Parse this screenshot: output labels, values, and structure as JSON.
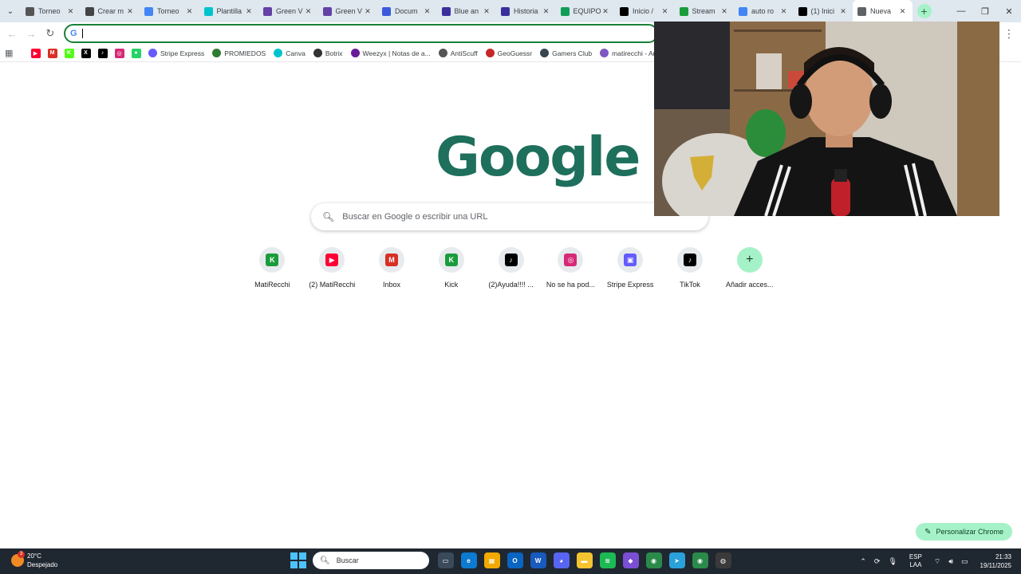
{
  "tabs": [
    {
      "title": "Torneo",
      "icon": "github-icon",
      "color": "#555555"
    },
    {
      "title": "Crear m",
      "icon": "openai-icon",
      "color": "#444444"
    },
    {
      "title": "Torneo",
      "icon": "docs-icon",
      "color": "#4285f4"
    },
    {
      "title": "Plantilla",
      "icon": "canva-icon",
      "color": "#00c4cc"
    },
    {
      "title": "Green V",
      "icon": "twitch-icon",
      "color": "#6441a5"
    },
    {
      "title": "Green V",
      "icon": "twitch-icon",
      "color": "#6441a5"
    },
    {
      "title": "Docum",
      "icon": "docs-icon",
      "color": "#3b5bdb"
    },
    {
      "title": "Blue an",
      "icon": "video-icon",
      "color": "#3b2f9e"
    },
    {
      "title": "Historia",
      "icon": "video-icon",
      "color": "#3b2f9e"
    },
    {
      "title": "EQUIPO",
      "icon": "sheets-icon",
      "color": "#0f9d58"
    },
    {
      "title": "Inicio /",
      "icon": "x-icon",
      "color": "#000000"
    },
    {
      "title": "Stream",
      "icon": "kick-icon",
      "color": "#1a9c3c"
    },
    {
      "title": "auto ro",
      "icon": "google-icon",
      "color": "#4285f4"
    },
    {
      "title": "(1) Inici",
      "icon": "x-icon",
      "color": "#000000"
    },
    {
      "title": "Nueva",
      "icon": "chrome-icon",
      "color": "#5f6368",
      "active": true
    }
  ],
  "bookmark_icons": [
    {
      "name": "youtube-bookmark",
      "color": "#ff0033",
      "glyph": "▶"
    },
    {
      "name": "gmail-bookmark",
      "color": "#d93025",
      "glyph": "M"
    },
    {
      "name": "kick-bookmark",
      "color": "#53fc18",
      "glyph": "K"
    },
    {
      "name": "x-bookmark",
      "color": "#000000",
      "glyph": "X"
    },
    {
      "name": "tiktok-bookmark",
      "color": "#000000",
      "glyph": "♪"
    },
    {
      "name": "instagram-bookmark",
      "color": "#d62976",
      "glyph": "◎"
    },
    {
      "name": "whatsapp-bookmark",
      "color": "#25d366",
      "glyph": "●"
    }
  ],
  "bookmarks": [
    {
      "label": "Stripe Express",
      "color": "#635bff"
    },
    {
      "label": "PROMIEDOS",
      "color": "#2e7d32"
    },
    {
      "label": "Canva",
      "color": "#00c4cc"
    },
    {
      "label": "Botrix",
      "color": "#333333"
    },
    {
      "label": "Weezyx | Notas de a...",
      "color": "#6a1b9a"
    },
    {
      "label": "AntiScuff",
      "color": "#555555"
    },
    {
      "label": "GeoGuessr",
      "color": "#c62828"
    },
    {
      "label": "Gamers Club",
      "color": "#37474f"
    },
    {
      "label": "matirecchi - Audien...",
      "color": "#7e57c2"
    }
  ],
  "logo_text": "Google",
  "search_placeholder": "Buscar en Google o escribir una URL",
  "shortcuts": [
    {
      "label": "MatiRecchi",
      "color": "#1a9c3c",
      "glyph": "K"
    },
    {
      "label": "(2) MatiRecchi",
      "color": "#ff0033",
      "glyph": "▶"
    },
    {
      "label": "Inbox",
      "color": "#d93025",
      "glyph": "M"
    },
    {
      "label": "Kick",
      "color": "#1a9c3c",
      "glyph": "K"
    },
    {
      "label": "(2)Ayuda!!!! ...",
      "color": "#000000",
      "glyph": "♪"
    },
    {
      "label": "No se ha pod...",
      "color": "#d62976",
      "glyph": "◎"
    },
    {
      "label": "Stripe Express",
      "color": "#635bff",
      "glyph": "▣"
    },
    {
      "label": "TikTok",
      "color": "#000000",
      "glyph": "♪"
    }
  ],
  "add_shortcut_label": "Añadir acces...",
  "customize_label": "Personalizar Chrome",
  "weather": {
    "temp": "20°C",
    "condition": "Despejado",
    "badge": "3"
  },
  "taskbar_search": "Buscar",
  "taskbar_apps": [
    {
      "name": "task-view-app",
      "color": "#3a4a5a",
      "glyph": "▭"
    },
    {
      "name": "edge-app",
      "color": "#0c7bd0",
      "glyph": "e"
    },
    {
      "name": "store-app",
      "color": "#f2a900",
      "glyph": "▦"
    },
    {
      "name": "outlook-app",
      "color": "#0a64c2",
      "glyph": "O"
    },
    {
      "name": "word-app",
      "color": "#185abd",
      "glyph": "W"
    },
    {
      "name": "discord-app",
      "color": "#5865f2",
      "glyph": "◕"
    },
    {
      "name": "explorer-app",
      "color": "#f4c430",
      "glyph": "▬"
    },
    {
      "name": "spotify-app",
      "color": "#1db954",
      "glyph": "≋"
    },
    {
      "name": "m365-app",
      "color": "#7b4fd4",
      "glyph": "◆"
    },
    {
      "name": "chrome-app",
      "color": "#2a8a4a",
      "glyph": "◉"
    },
    {
      "name": "telegram-app",
      "color": "#2aa1da",
      "glyph": "➤"
    },
    {
      "name": "chrome-active-app",
      "color": "#2a8a4a",
      "glyph": "◉"
    },
    {
      "name": "obs-app",
      "color": "#3a3a3a",
      "glyph": "◍"
    }
  ],
  "language": {
    "line1": "ESP",
    "line2": "LAA"
  },
  "clock": {
    "time": "21:33",
    "date": "19/11/2025"
  }
}
